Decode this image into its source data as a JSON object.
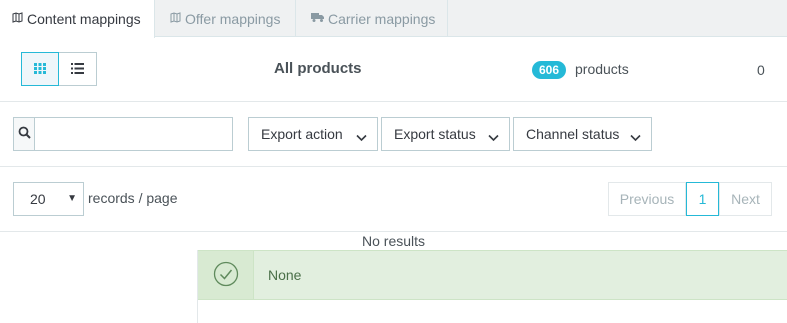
{
  "tabs": [
    {
      "label": "Content mappings",
      "icon": "map-icon",
      "active": true
    },
    {
      "label": "Offer mappings",
      "icon": "map-icon",
      "active": false
    },
    {
      "label": "Carrier mappings",
      "icon": "truck-icon",
      "active": false
    }
  ],
  "toolbar": {
    "title": "All products",
    "product_count": "606",
    "product_count_label": "products",
    "right_count": "0"
  },
  "search": {
    "placeholder": "",
    "value": ""
  },
  "filters": {
    "export_action": "Export action",
    "export_status": "Export status",
    "channel_status": "Channel status"
  },
  "pagination": {
    "per_page": "20",
    "records_label": "records / page",
    "previous": "Previous",
    "current": "1",
    "next": "Next"
  },
  "results": {
    "no_results": "No results",
    "alert_text": "None"
  },
  "colors": {
    "accent": "#25b9d7",
    "success_bg": "#e2efdf",
    "success_icon": "#4a8a4a"
  }
}
